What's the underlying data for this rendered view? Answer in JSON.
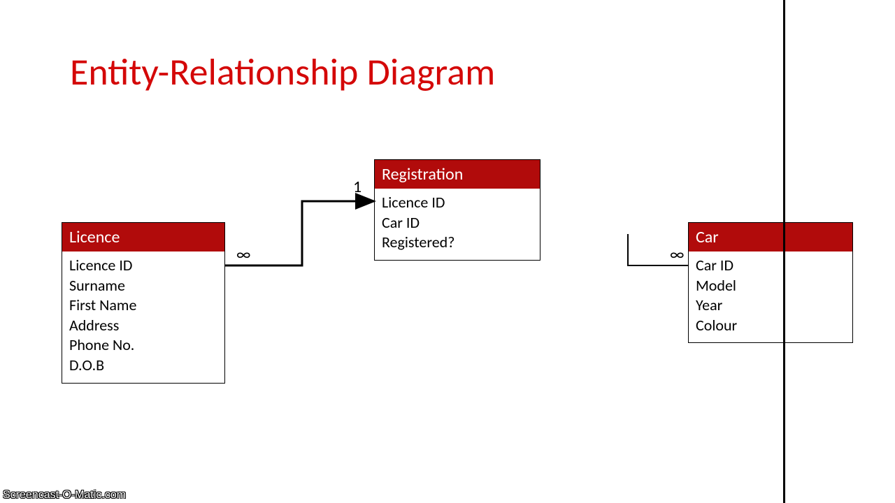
{
  "title": "Entity-Relationship Diagram",
  "entities": {
    "licence": {
      "name": "Licence",
      "attrs": [
        "Licence ID",
        "Surname",
        "First Name",
        "Address",
        "Phone No.",
        "D.O.B"
      ]
    },
    "registration": {
      "name": "Registration",
      "attrs": [
        "Licence ID",
        "Car ID",
        "Registered?"
      ]
    },
    "car": {
      "name": "Car",
      "attrs": [
        "Car ID",
        "Model",
        "Year",
        "Colour"
      ]
    }
  },
  "cardinalities": {
    "licence_side": "∞",
    "registration_side": "1",
    "car_side": "∞"
  },
  "watermark": "Screencast-O-Matic.com"
}
